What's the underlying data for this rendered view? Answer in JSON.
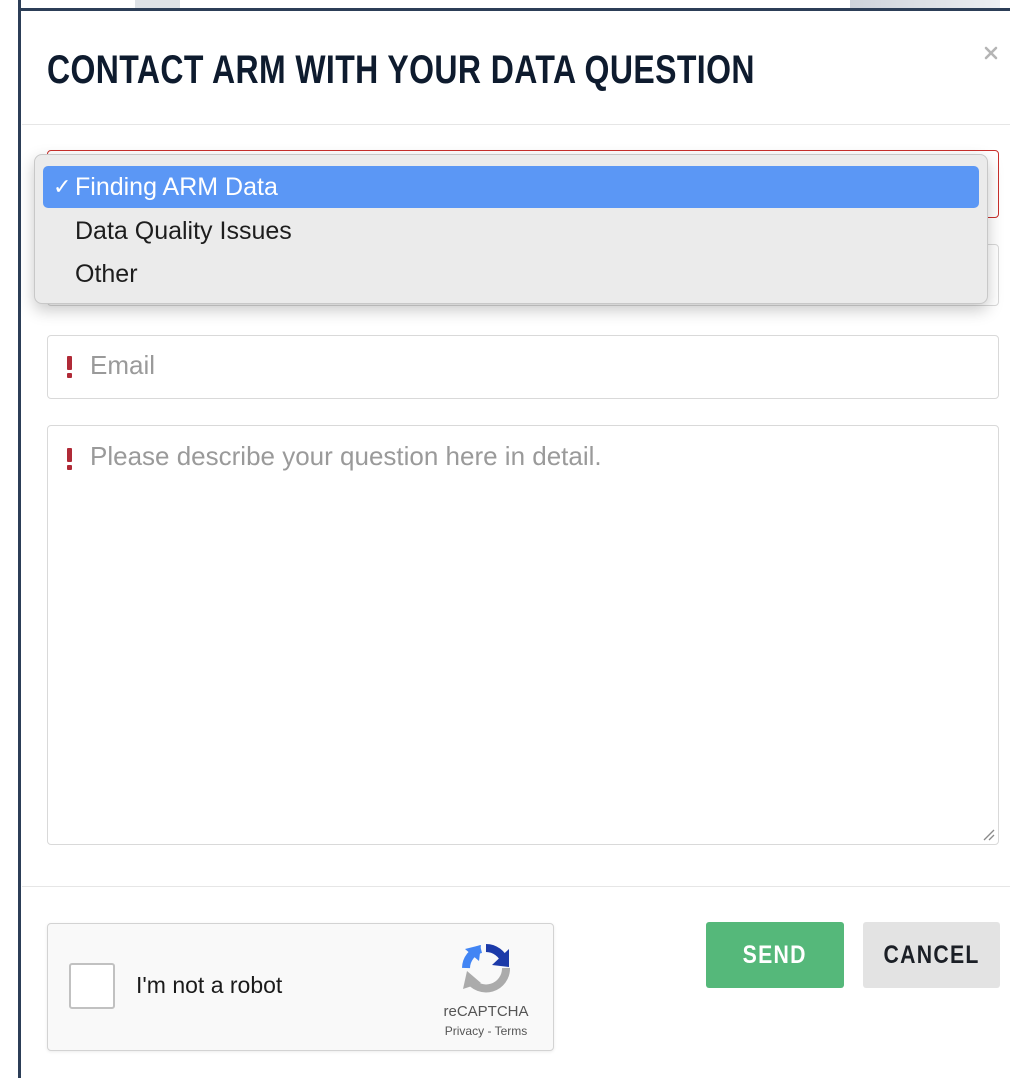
{
  "modal": {
    "title": "CONTACT ARM WITH YOUR DATA QUESTION",
    "close_icon": "close-icon"
  },
  "form": {
    "topic_select": {
      "selected": "Finding ARM Data",
      "options": [
        {
          "label": "Finding ARM Data",
          "selected": true,
          "check": "✓"
        },
        {
          "label": "Data Quality Issues",
          "selected": false,
          "check": ""
        },
        {
          "label": "Other",
          "selected": false,
          "check": ""
        }
      ]
    },
    "email": {
      "placeholder": "Email",
      "value": "",
      "required": true
    },
    "question": {
      "placeholder": "Please describe your question here in detail.",
      "value": "",
      "required": true
    }
  },
  "recaptcha": {
    "label": "I'm not a robot",
    "brand": "reCAPTCHA",
    "privacy": "Privacy",
    "separator": " - ",
    "terms": "Terms",
    "checked": false
  },
  "buttons": {
    "send": "SEND",
    "cancel": "CANCEL"
  },
  "colors": {
    "title": "#0e1b2e",
    "required": "#b02a37",
    "select_border": "#c9302c",
    "selected_option": "#5b97f5",
    "send_bg": "#55b87a",
    "cancel_bg": "#e3e3e3"
  }
}
